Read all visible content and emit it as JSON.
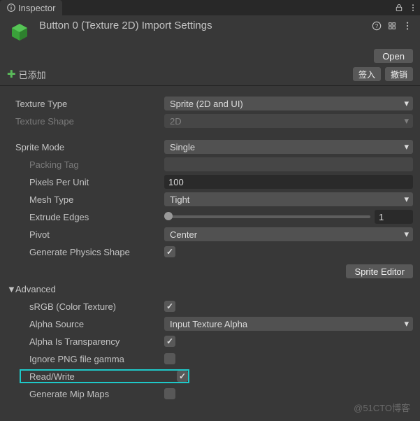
{
  "tab": {
    "title": "Inspector"
  },
  "header": {
    "title": "Button 0 (Texture 2D) Import Settings",
    "open": "Open"
  },
  "status": {
    "added": "已添加",
    "checkin": "签入",
    "revert": "撤销"
  },
  "texture_type": {
    "label": "Texture Type",
    "value": "Sprite (2D and UI)"
  },
  "texture_shape": {
    "label": "Texture Shape",
    "value": "2D"
  },
  "sprite_mode": {
    "label": "Sprite Mode",
    "value": "Single"
  },
  "packing_tag": {
    "label": "Packing Tag",
    "value": ""
  },
  "pixels_per_unit": {
    "label": "Pixels Per Unit",
    "value": "100"
  },
  "mesh_type": {
    "label": "Mesh Type",
    "value": "Tight"
  },
  "extrude_edges": {
    "label": "Extrude Edges",
    "value": "1"
  },
  "pivot": {
    "label": "Pivot",
    "value": "Center"
  },
  "gen_physics": {
    "label": "Generate Physics Shape"
  },
  "sprite_editor": "Sprite Editor",
  "advanced": {
    "label": "Advanced"
  },
  "srgb": {
    "label": "sRGB (Color Texture)"
  },
  "alpha_source": {
    "label": "Alpha Source",
    "value": "Input Texture Alpha"
  },
  "alpha_transparency": {
    "label": "Alpha Is Transparency"
  },
  "ignore_png_gamma": {
    "label": "Ignore PNG file gamma"
  },
  "read_write": {
    "label": "Read/Write"
  },
  "gen_mipmaps": {
    "label": "Generate Mip Maps"
  },
  "watermark": "@51CTO博客"
}
